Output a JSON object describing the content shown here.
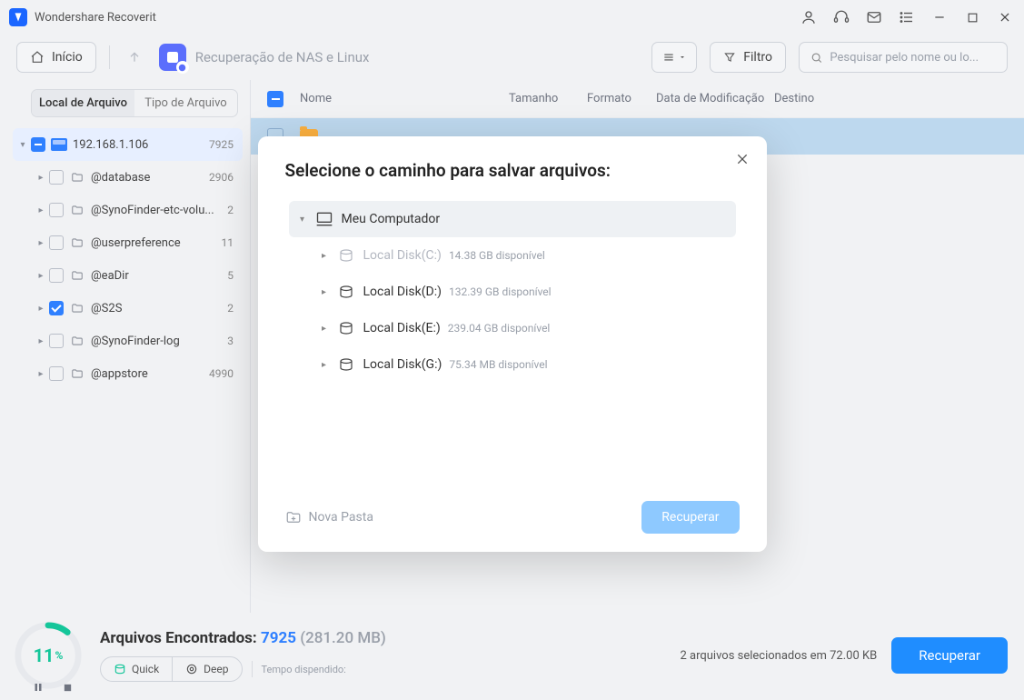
{
  "app": {
    "title": "Wondershare Recoverit"
  },
  "toolbar": {
    "home_label": "Início",
    "context_label": "Recuperação de NAS e Linux",
    "filter_label": "Filtro",
    "search_placeholder": "Pesquisar pelo nome ou lo..."
  },
  "sidebar": {
    "tabs": {
      "location": "Local de Arquivo",
      "type": "Tipo de Arquivo"
    },
    "root": {
      "label": "192.168.1.106",
      "count": "7925"
    },
    "items": [
      {
        "label": "@database",
        "count": "2906"
      },
      {
        "label": "@SynoFinder-etc-volu...",
        "count": "2"
      },
      {
        "label": "@userpreference",
        "count": "11"
      },
      {
        "label": "@eaDir",
        "count": "5"
      },
      {
        "label": "@S2S",
        "count": "2"
      },
      {
        "label": "@SynoFinder-log",
        "count": "3"
      },
      {
        "label": "@appstore",
        "count": "4990"
      }
    ]
  },
  "table": {
    "headers": {
      "name": "Nome",
      "size": "Tamanho",
      "format": "Formato",
      "modified": "Data de Modificação",
      "dest": "Destino"
    }
  },
  "footer": {
    "percent": "11",
    "percent_suffix": "%",
    "found_label": "Arquivos Encontrados:",
    "found_count": "7925",
    "found_size": "(281.20 MB)",
    "quick_label": "Quick",
    "deep_label": "Deep",
    "time_label": "Tempo dispendido:",
    "selection_info": "2 arquivos selecionados em 72.00 KB",
    "recover_label": "Recuperar"
  },
  "modal": {
    "title": "Selecione o caminho para salvar arquivos:",
    "root_label": "Meu Computador",
    "disks": [
      {
        "label": "Local Disk(C:)",
        "free": "14.38 GB disponível",
        "disabled": true
      },
      {
        "label": "Local Disk(D:)",
        "free": "132.39 GB disponível",
        "disabled": false
      },
      {
        "label": "Local Disk(E:)",
        "free": "239.04 GB disponível",
        "disabled": false
      },
      {
        "label": "Local Disk(G:)",
        "free": "75.34 MB disponível",
        "disabled": false
      }
    ],
    "new_folder_label": "Nova Pasta",
    "recover_label": "Recuperar"
  }
}
